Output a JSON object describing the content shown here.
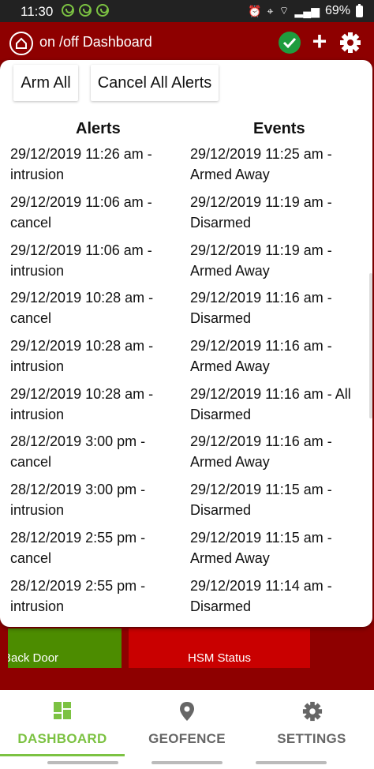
{
  "status_bar": {
    "time": "11:30",
    "battery": "69%"
  },
  "app_bar": {
    "title": "on /off Dashboard"
  },
  "popup": {
    "arm_all_label": "Arm All",
    "cancel_all_label": "Cancel All Alerts",
    "alerts_heading": "Alerts",
    "events_heading": "Events",
    "alerts": [
      "29/12/2019 11:26 am - intrusion",
      "29/12/2019 11:06 am - cancel",
      "29/12/2019 11:06 am - intrusion",
      "29/12/2019 10:28 am - cancel",
      "29/12/2019 10:28 am - intrusion",
      "29/12/2019 10:28 am - intrusion",
      "28/12/2019 3:00 pm - cancel",
      "28/12/2019 3:00 pm - intrusion",
      "28/12/2019 2:55 pm - cancel",
      "28/12/2019 2:55 pm - intrusion"
    ],
    "events": [
      "29/12/2019 11:25 am - Armed Away",
      "29/12/2019 11:19 am - Disarmed",
      "29/12/2019 11:19 am - Armed Away",
      "29/12/2019 11:16 am - Disarmed",
      "29/12/2019 11:16 am - Armed Away",
      "29/12/2019 11:16 am - All Disarmed",
      "29/12/2019 11:16 am - Armed Away",
      "29/12/2019 11:15 am - Disarmed",
      "29/12/2019 11:15 am - Armed Away",
      "29/12/2019 11:14 am - Disarmed"
    ]
  },
  "tiles": {
    "back_door": "Back Door",
    "hsm_status": "HSM Status"
  },
  "bottom_nav": {
    "dashboard": "DASHBOARD",
    "geofence": "GEOFENCE",
    "settings": "SETTINGS"
  },
  "colors": {
    "brand_red": "#8e0000",
    "accent_green": "#7cc242",
    "ok_green": "#1e9c3e",
    "hsm_red": "#c90000",
    "back_door_green": "#4c8c00"
  },
  "icons": [
    "hubitat-icon",
    "check-circle-icon",
    "plus-icon",
    "gear-icon",
    "dashboard-icon",
    "location-pin-icon",
    "settings-icon"
  ]
}
